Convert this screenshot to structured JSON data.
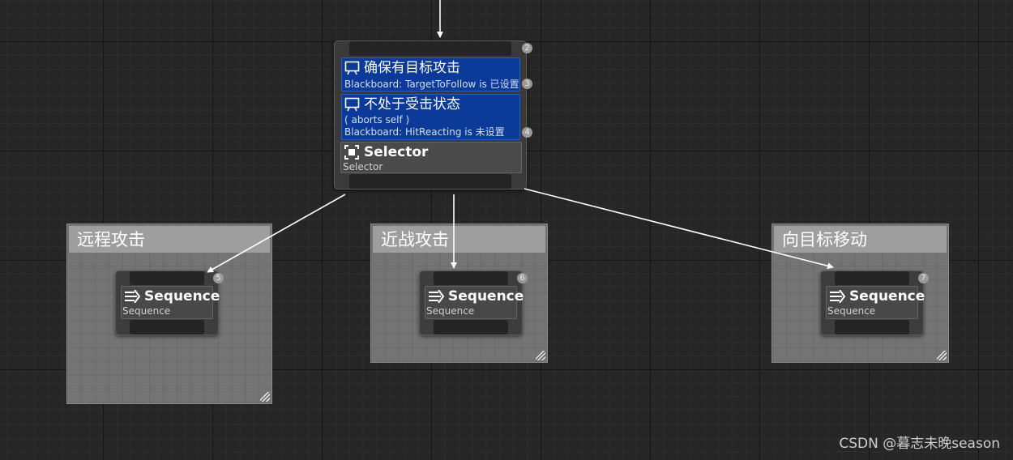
{
  "root_node": {
    "index_badge": "2",
    "decorators": [
      {
        "title": "确保有目标攻击",
        "lines": [
          "Blackboard: TargetToFollow is 已设置"
        ],
        "index_badge": "3"
      },
      {
        "title": "不处于受击状态",
        "lines": [
          "( aborts self )",
          "Blackboard: HitReacting is 未设置"
        ],
        "index_badge": "4"
      }
    ],
    "composite": {
      "title": "Selector",
      "subtitle": "Selector"
    }
  },
  "comments": [
    {
      "title": "远程攻击",
      "child": {
        "title": "Sequence",
        "subtitle": "Sequence",
        "index_badge": "5"
      }
    },
    {
      "title": "近战攻击",
      "child": {
        "title": "Sequence",
        "subtitle": "Sequence",
        "index_badge": "6"
      }
    },
    {
      "title": "向目标移动",
      "child": {
        "title": "Sequence",
        "subtitle": "Sequence",
        "index_badge": "7"
      }
    }
  ],
  "watermark": "CSDN @暮志未晚season",
  "colors": {
    "graph_background": "#262626",
    "decorator_blue": "#0b3a99",
    "comment_fill": "#747474",
    "comment_header": "#9e9e9e",
    "wire": "#ffffff"
  },
  "icons": [
    "decorator-icon",
    "selector-icon",
    "sequence-icon",
    "resize-handle-icon"
  ]
}
